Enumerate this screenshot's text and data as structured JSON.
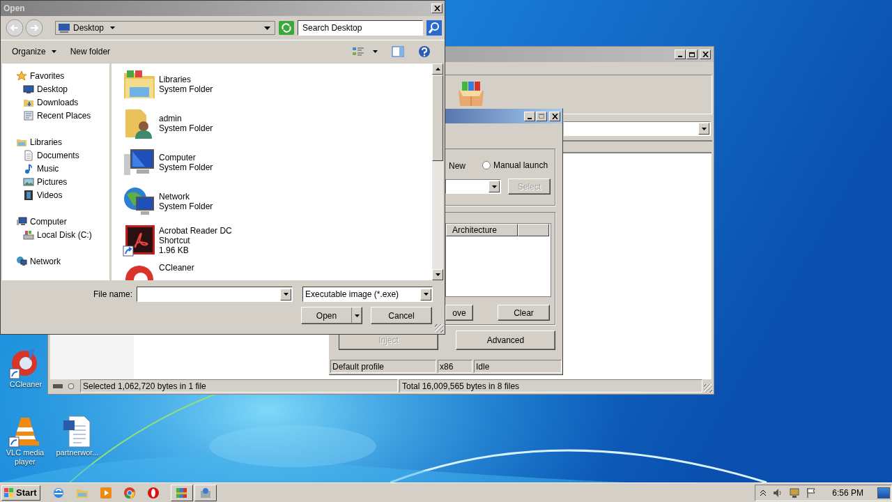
{
  "desktop": {
    "icons": [
      {
        "kind": "ccleaner",
        "label": "CCleaner"
      },
      {
        "kind": "vlc",
        "label": "VLC media player"
      },
      {
        "kind": "document",
        "label": "partnerwor..."
      }
    ]
  },
  "file_manager": {
    "status_bar": {
      "selected": "Selected 1,062,720 bytes in 1 file",
      "total": "Total 16,009,565 bytes in 8 files"
    }
  },
  "injector": {
    "new_label": "New",
    "manual_launch": {
      "label": "Manual launch",
      "selected": false
    },
    "select_button": {
      "label": "Select",
      "disabled": true
    },
    "columns": [
      "Architecture"
    ],
    "buttons": [
      {
        "kind": "remove",
        "label": "ove",
        "disabled": false
      },
      {
        "kind": "clear",
        "label": "Clear",
        "disabled": false
      },
      {
        "kind": "inject",
        "label": "Inject",
        "disabled": true
      },
      {
        "kind": "advanced",
        "label": "Advanced",
        "disabled": false
      }
    ],
    "status_bar": [
      "Default profile",
      "x86",
      "Idle"
    ]
  },
  "open_dialog": {
    "title": "Open",
    "location": "Desktop",
    "search": {
      "placeholder": "Search Desktop"
    },
    "toolbar": [
      {
        "label": "Organize",
        "has_menu": true
      },
      {
        "label": "New folder",
        "has_menu": false
      }
    ],
    "nav_tree": [
      {
        "kind": "favorites",
        "label": "Favorites",
        "children": [
          {
            "kind": "desktop",
            "label": "Desktop"
          },
          {
            "kind": "downloads",
            "label": "Downloads"
          },
          {
            "kind": "recent",
            "label": "Recent Places"
          }
        ]
      },
      {
        "kind": "libraries",
        "label": "Libraries",
        "children": [
          {
            "kind": "documents",
            "label": "Documents"
          },
          {
            "kind": "music",
            "label": "Music"
          },
          {
            "kind": "pictures",
            "label": "Pictures"
          },
          {
            "kind": "videos",
            "label": "Videos"
          }
        ]
      },
      {
        "kind": "computer",
        "label": "Computer",
        "children": [
          {
            "kind": "disk",
            "label": "Local Disk (C:)"
          }
        ]
      },
      {
        "kind": "network",
        "label": "Network"
      }
    ],
    "files": [
      {
        "kind": "library",
        "name": "Libraries",
        "details": [
          "System Folder"
        ]
      },
      {
        "kind": "user",
        "name": "admin",
        "details": [
          "System Folder"
        ]
      },
      {
        "kind": "computer",
        "name": "Computer",
        "details": [
          "System Folder"
        ]
      },
      {
        "kind": "network",
        "name": "Network",
        "details": [
          "System Folder"
        ]
      },
      {
        "kind": "pdf",
        "name": "Acrobat Reader DC",
        "details": [
          "Shortcut",
          "1.96 KB"
        ]
      },
      {
        "kind": "ccleaner",
        "name": "CCleaner"
      }
    ],
    "file_name": {
      "label": "File name:"
    },
    "file_type": "Executable image (*.exe)",
    "buttons": [
      "Open",
      "Cancel"
    ]
  },
  "taskbar": {
    "start": "Start",
    "clock": "6:56 PM"
  }
}
